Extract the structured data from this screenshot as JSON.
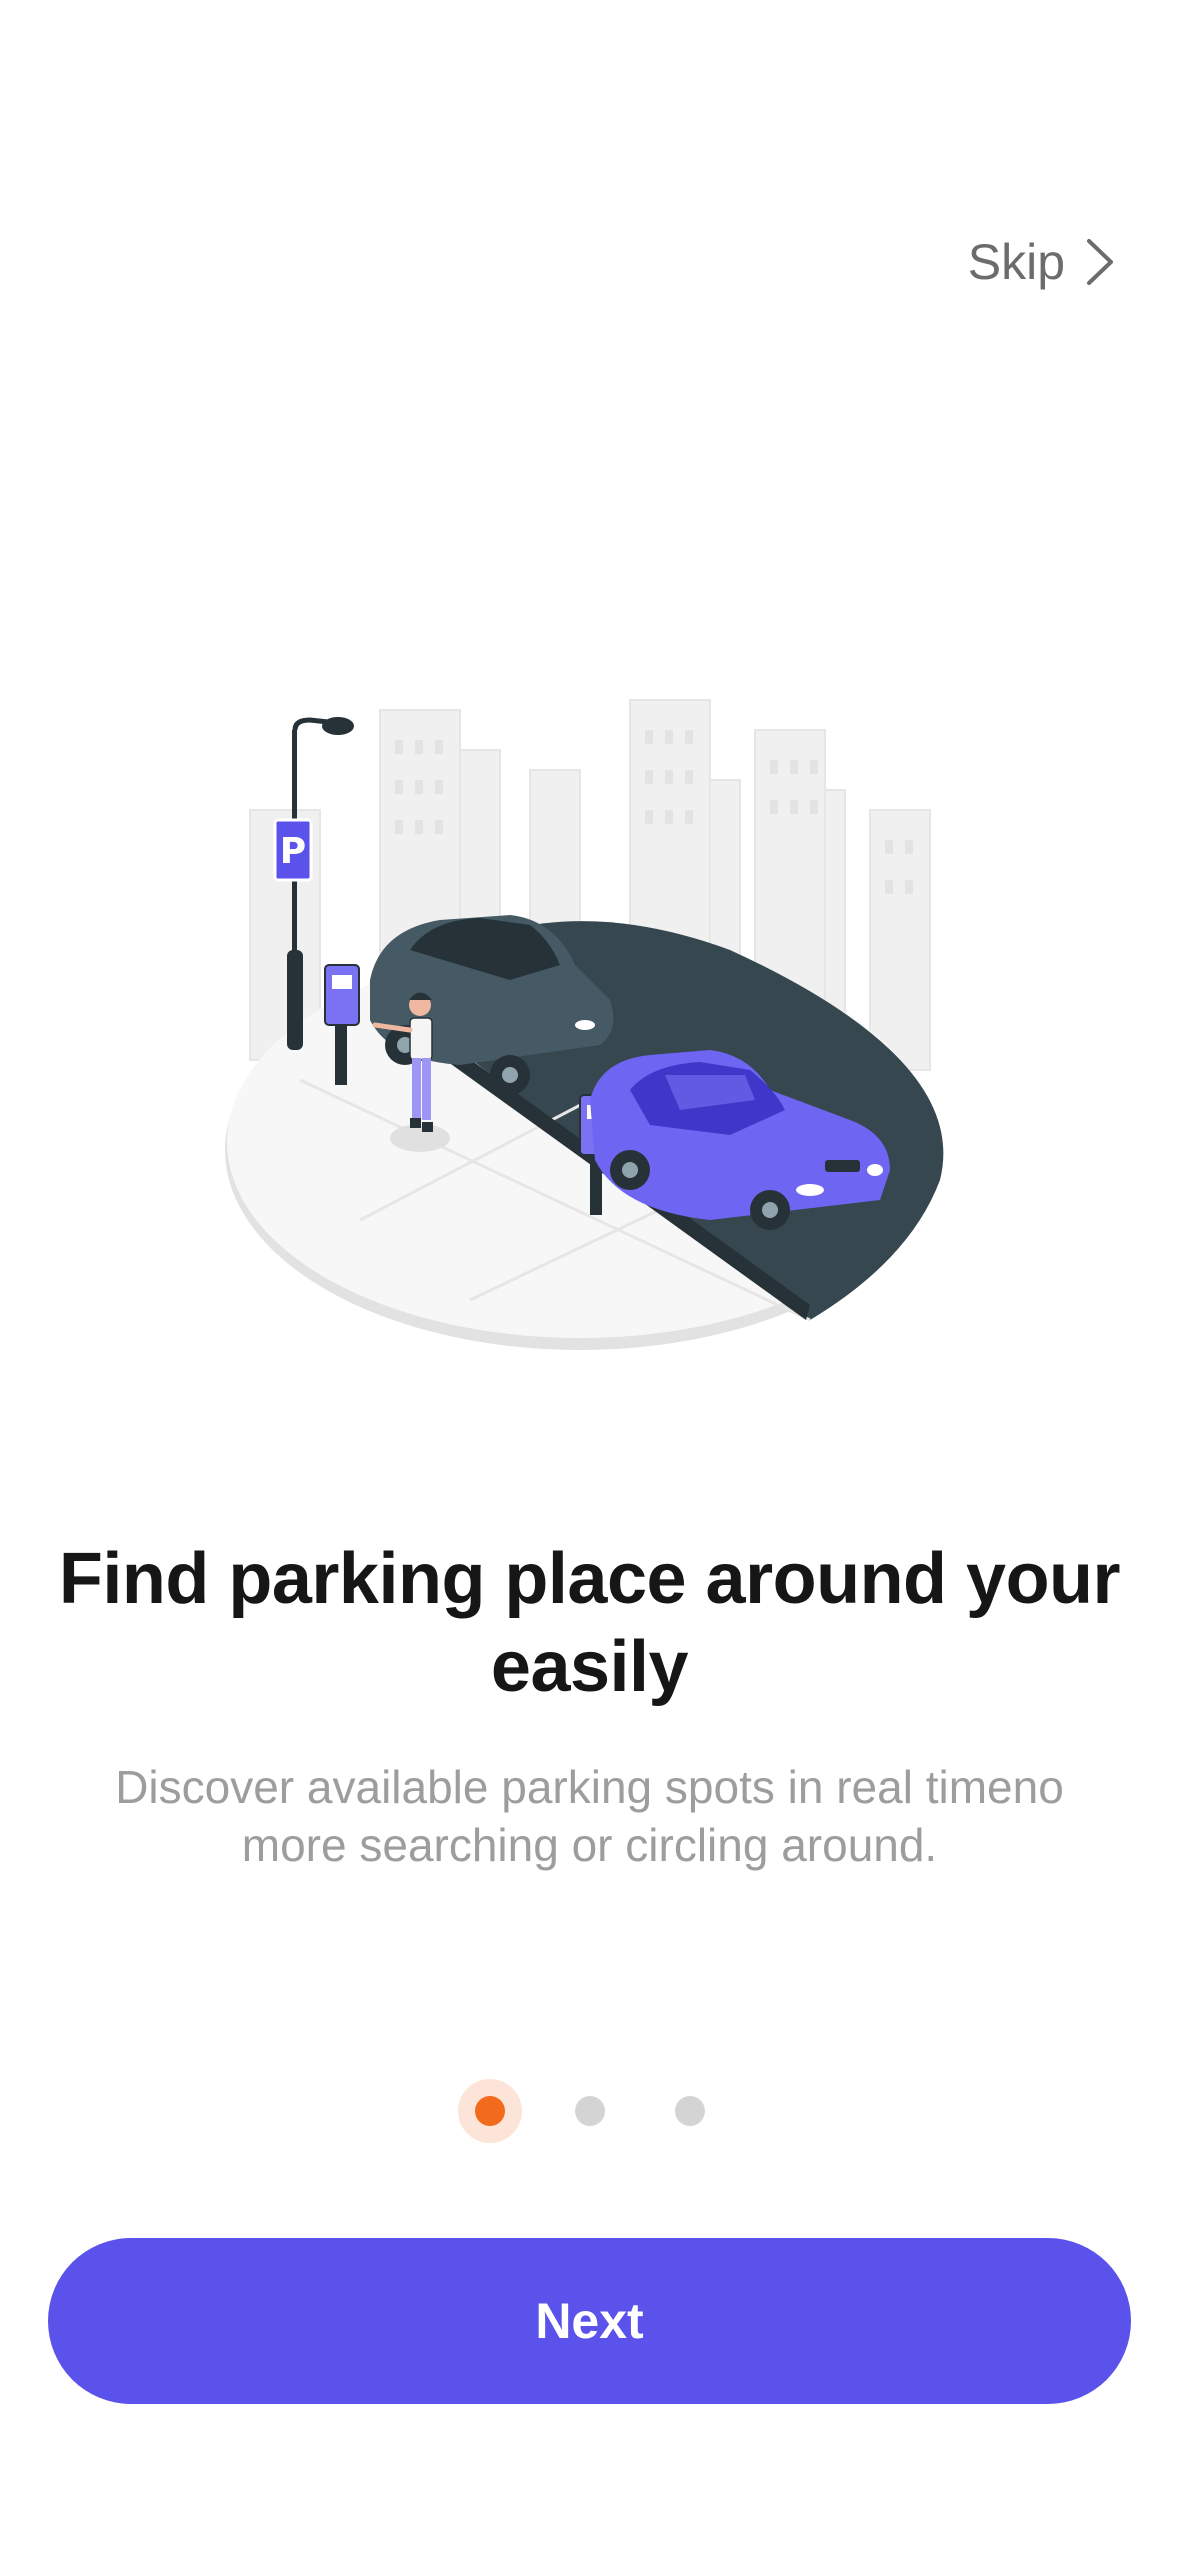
{
  "header": {
    "skip_label": "Skip",
    "skip_icon": "chevron-right-icon"
  },
  "onboarding": {
    "illustration": "parking-lot-illustration",
    "title": "Find parking place around your easily",
    "subtitle": "Discover available parking spots in real timeno more searching or circling around."
  },
  "pagination": {
    "current_page": 1,
    "total_pages": 3,
    "active_color": "#f26b1d",
    "inactive_color": "#d4d4d4"
  },
  "actions": {
    "next_label": "Next",
    "next_color": "#5b52ec"
  }
}
